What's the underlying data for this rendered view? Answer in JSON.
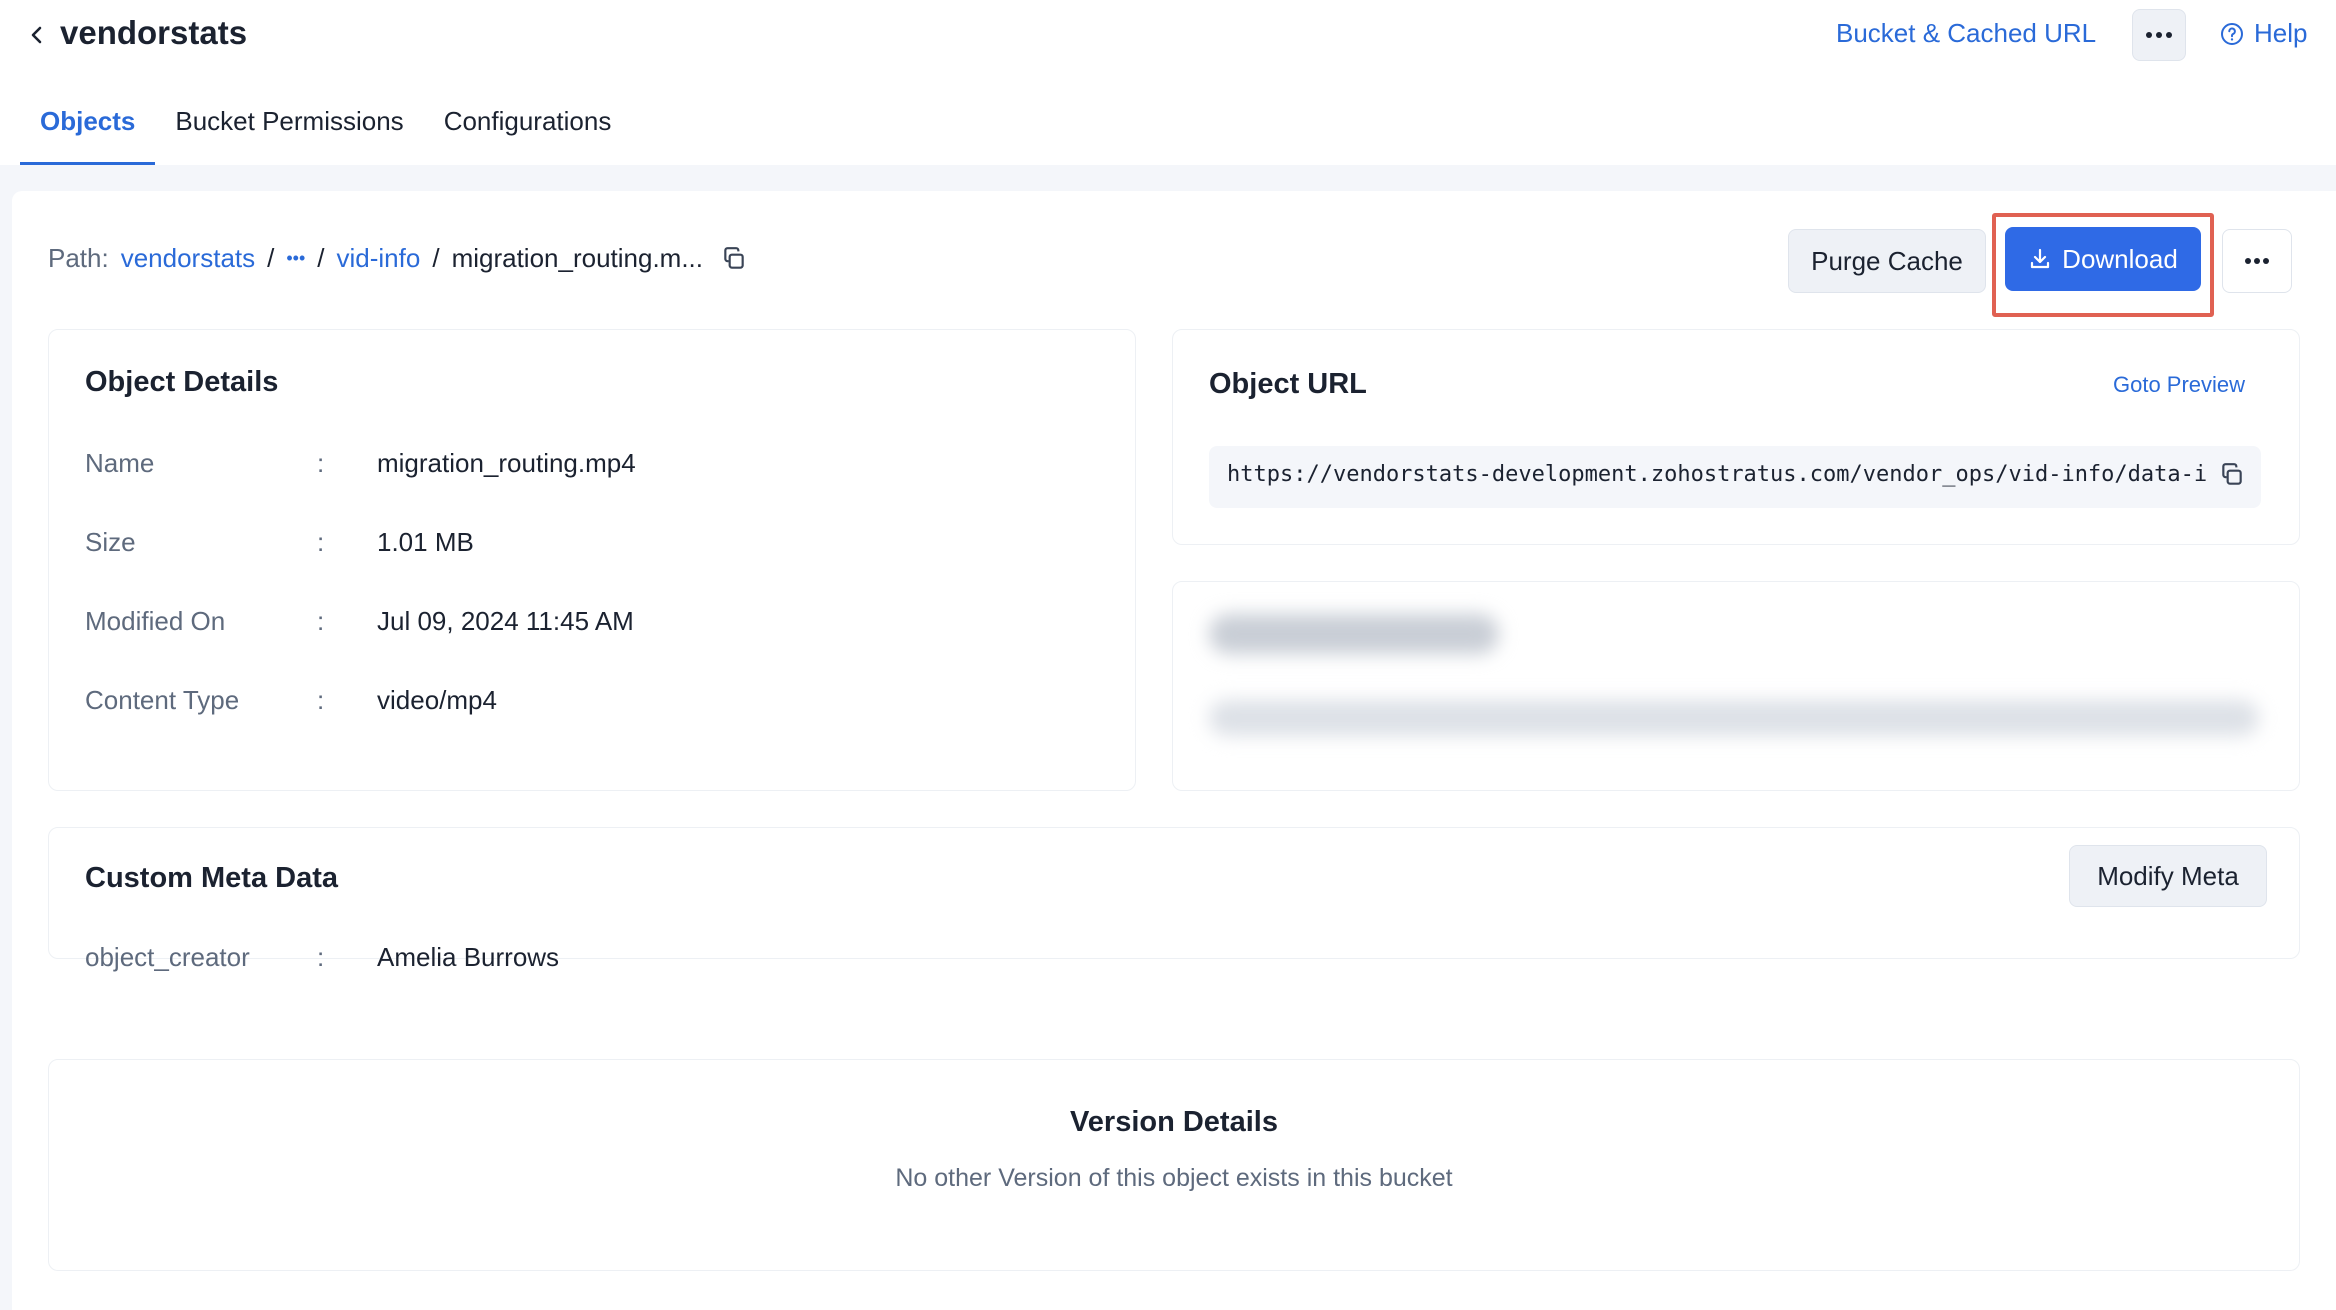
{
  "header": {
    "bucket_name": "vendorstats",
    "bucket_cached_url_label": "Bucket & Cached URL",
    "help_label": "Help"
  },
  "tabs": [
    {
      "label": "Objects",
      "active": true
    },
    {
      "label": "Bucket Permissions",
      "active": false
    },
    {
      "label": "Configurations",
      "active": false
    }
  ],
  "path": {
    "label": "Path:",
    "root": "vendorstats",
    "ellipsis": "•••",
    "folder": "vid-info",
    "file": "migration_routing.m...",
    "separator": "/"
  },
  "actions": {
    "purge_cache_label": "Purge Cache",
    "download_label": "Download"
  },
  "object_details": {
    "title": "Object Details",
    "rows": [
      {
        "key": "Name",
        "value": "migration_routing.mp4"
      },
      {
        "key": "Size",
        "value": "1.01 MB"
      },
      {
        "key": "Modified On",
        "value": "Jul 09, 2024 11:45 AM"
      },
      {
        "key": "Content Type",
        "value": "video/mp4"
      }
    ],
    "colon": ":"
  },
  "object_url": {
    "title": "Object URL",
    "goto_preview_label": "Goto Preview",
    "url": "https://vendorstats-development.zohostratus.com/vendor_ops/vid-info/data-ir"
  },
  "custom_meta": {
    "title": "Custom Meta Data",
    "modify_label": "Modify Meta",
    "rows": [
      {
        "key": "object_creator",
        "value": "Amelia Burrows"
      }
    ]
  },
  "version_details": {
    "title": "Version Details",
    "message": "No other Version of this object exists in this bucket"
  },
  "colors": {
    "accent": "#2a6ad8",
    "download_bg": "#2f6ae6",
    "highlight": "#e06152"
  }
}
